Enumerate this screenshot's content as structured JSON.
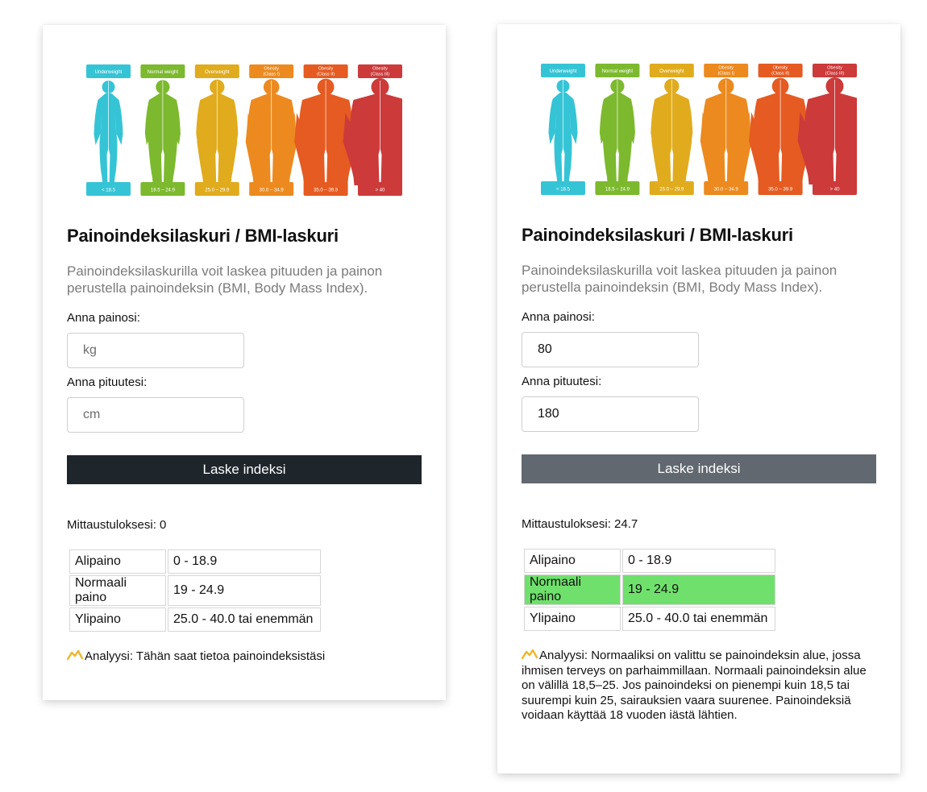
{
  "figure": {
    "categories": [
      {
        "label": [
          "Underweight"
        ],
        "range": "< 18.5",
        "color": "#35c4d6"
      },
      {
        "label": [
          "Normal weight"
        ],
        "range": "18.5 – 24.9",
        "color": "#7cb92e"
      },
      {
        "label": [
          "Overweight"
        ],
        "range": "25.0 – 29.9",
        "color": "#e0ab1d"
      },
      {
        "label": [
          "Obesity",
          "(Class I)"
        ],
        "range": "30.0 – 34.9",
        "color": "#ec8a1f"
      },
      {
        "label": [
          "Obesity",
          "(Class II)"
        ],
        "range": "35.0 – 39.9",
        "color": "#e55b21"
      },
      {
        "label": [
          "Obesity",
          "(Class III)"
        ],
        "range": "> 40",
        "color": "#cc3a3a"
      }
    ]
  },
  "left": {
    "title": "Painoindeksilaskuri / BMI-laskuri",
    "lead": "Painoindeksilaskurilla voit laskea pituuden ja painon perustella painoindeksin (BMI, Body Mass Index).",
    "weight_label": "Anna painosi:",
    "weight_placeholder": "kg",
    "weight_value": "",
    "height_label": "Anna pituutesi:",
    "height_placeholder": "cm",
    "height_value": "",
    "button_label": "Laske indeksi",
    "result_text": "Mittaustuloksesi: 0",
    "rows": [
      {
        "name": "Alipaino",
        "range": "0 - 18.9"
      },
      {
        "name": "Normaali paino",
        "range": "19 - 24.9"
      },
      {
        "name": "Ylipaino",
        "range": "25.0 - 40.0 tai enemmän"
      }
    ],
    "analysis": "Analyysi: Tähän saat tietoa painoindeksistäsi"
  },
  "right": {
    "title": "Painoindeksilaskuri / BMI-laskuri",
    "lead": "Painoindeksilaskurilla voit laskea pituuden ja painon perustella painoindeksin (BMI, Body Mass Index).",
    "weight_label": "Anna painosi:",
    "weight_placeholder": "kg",
    "weight_value": "80",
    "height_label": "Anna pituutesi:",
    "height_placeholder": "cm",
    "height_value": "180",
    "button_label": "Laske indeksi",
    "result_text": "Mittaustuloksesi: 24.7",
    "rows": [
      {
        "name": "Alipaino",
        "range": "0 - 18.9"
      },
      {
        "name": "Normaali paino",
        "range": "19 - 24.9"
      },
      {
        "name": "Ylipaino",
        "range": "25.0 - 40.0 tai enemmän"
      }
    ],
    "highlight_color": "#70e06d",
    "analysis": "Analyysi: Normaaliksi on valittu se painoindeksin alue, jossa ihmisen terveys on parhaimmillaan. Normaali painoindeksin alue on välillä 18,5–25. Jos painoindeksi on pienempi kuin 18,5 tai suurempi kuin 25, sairauksien vaara suurenee. Painoindeksiä voidaan käyttää 18 vuoden iästä lähtien."
  },
  "icons": {
    "analysis": "chart-trend-icon"
  }
}
